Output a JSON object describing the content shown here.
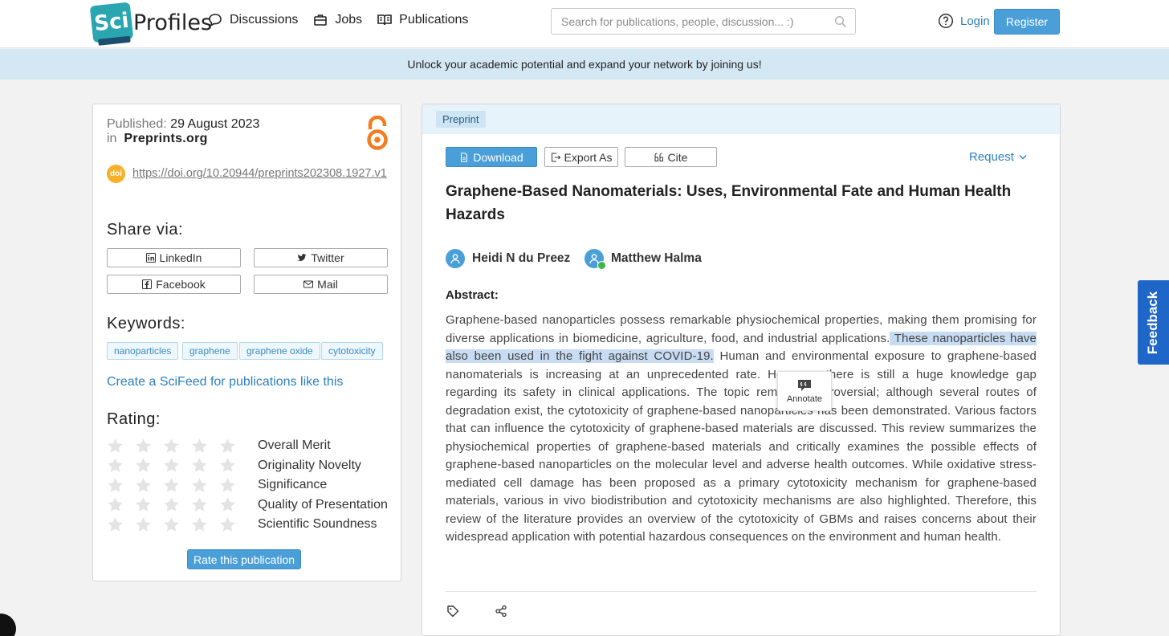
{
  "header": {
    "logo_mark": "Sci",
    "logo_text": "Profiles",
    "nav": [
      {
        "label": "Discussions",
        "icon": "chat-bubble-icon"
      },
      {
        "label": "Jobs",
        "icon": "briefcase-icon"
      },
      {
        "label": "Publications",
        "icon": "book-icon"
      }
    ],
    "search_placeholder": "Search for publications, people, discussion... :)",
    "login": "Login",
    "register": "Register",
    "accent_color": "#4a9fd8"
  },
  "banner": {
    "text": "Unlock your academic potential and expand your network by joining us!"
  },
  "sidebar": {
    "published_label": "Published:",
    "published_date": "29 August 2023",
    "in_label": "in",
    "venue": "Preprints.org",
    "doi_badge": "doi",
    "doi_url": "https://doi.org/10.20944/preprints202308.1927.v1",
    "share_heading": "Share via:",
    "share": [
      {
        "label": "LinkedIn",
        "icon": "linkedin-icon"
      },
      {
        "label": "Twitter",
        "icon": "twitter-icon"
      },
      {
        "label": "Facebook",
        "icon": "facebook-icon"
      },
      {
        "label": "Mail",
        "icon": "mail-icon"
      }
    ],
    "keywords_heading": "Keywords:",
    "keywords": [
      "nanoparticles",
      "graphene",
      "graphene oxide",
      "cytotoxicity"
    ],
    "scifeed_link": "Create a SciFeed for publications like this",
    "rating_heading": "Rating:",
    "ratings": [
      {
        "label": "Overall Merit",
        "stars": 0
      },
      {
        "label": "Originality Novelty",
        "stars": 0
      },
      {
        "label": "Significance",
        "stars": 0
      },
      {
        "label": "Quality of Presentation",
        "stars": 0
      },
      {
        "label": "Scientific Soundness",
        "stars": 0
      }
    ],
    "rate_button": "Rate this publication"
  },
  "article": {
    "type_badge": "Preprint",
    "actions": {
      "download": "Download",
      "export": "Export As",
      "cite": "Cite",
      "request": "Request"
    },
    "title": "Graphene-Based Nanomaterials: Uses, Environmental Fate and Human Health Hazards",
    "authors": [
      {
        "name": "Heidi N du Preez",
        "verified": false
      },
      {
        "name": "Matthew Halma",
        "verified": true
      }
    ],
    "abstract_heading": "Abstract:",
    "abstract_before": "Graphene-based nanoparticles possess remarkable physiochemical properties, making them promising for diverse applications in biomedicine, agriculture, food, and industrial applications.",
    "abstract_highlight": " These nanoparticles have also been used in the fight against COVID-19.",
    "abstract_after": " Human and environmental exposure to graphene-based nanomaterials is increasing at an unprecedented rate. However, there is still a huge knowledge gap regarding its safety in clinical applications. The topic remains controversial; although several routes of degradation exist, the cytotoxicity of graphene-based nanoparticles has been demonstrated. Various factors that can influence the cytotoxicity of graphene-based materials are discussed. This review summarizes the physiochemical properties of graphene-based materials and critically examines the possible effects of graphene-based nanoparticles on the molecular level and adverse health outcomes. While oxidative stress-mediated cell damage has been proposed as a primary cytotoxicity mechanism for graphene-based materials, various in vivo biodistribution and cytotoxicity mechanisms are also highlighted. Therefore, this review of the literature provides an overview of the cytotoxicity of GBMs and raises concerns about their widespread application with potential hazardous consequences on the environment and human health.",
    "annotate_label": "Annotate",
    "highlight_color": "#c7dcf2"
  },
  "feedback_tab": "Feedback"
}
